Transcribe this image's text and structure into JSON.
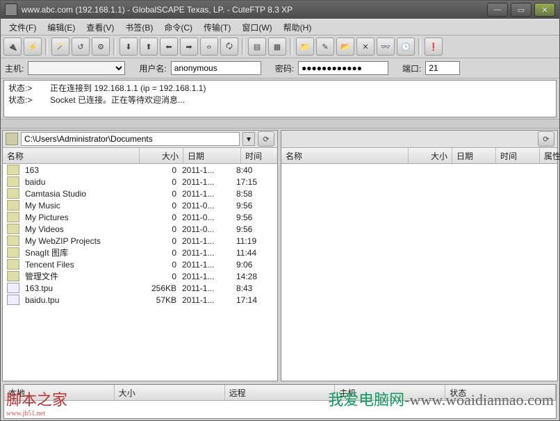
{
  "titlebar": {
    "title": "www.abc.com (192.168.1.1) - GlobalSCAPE Texas, LP. - CuteFTP 8.3 XP"
  },
  "menu": {
    "file": "文件(F)",
    "edit": "编辑(E)",
    "view": "查看(V)",
    "bookmark": "书签(B)",
    "command": "命令(C)",
    "transfer": "传输(T)",
    "window": "窗口(W)",
    "help": "帮助(H)"
  },
  "conn": {
    "host_label": "主机:",
    "host": "",
    "user_label": "用户名:",
    "user": "anonymous",
    "pass_label": "密码:",
    "pass": "●●●●●●●●●●●●",
    "port_label": "端口:",
    "port": "21"
  },
  "log": {
    "prefix": "状态:>",
    "line1": "正在连接到 192.168.1.1 (ip = 192.168.1.1)",
    "line2": "Socket 已连接。正在等待欢迎消息..."
  },
  "local": {
    "path": "C:\\Users\\Administrator\\Documents",
    "cols": {
      "name": "名称",
      "size": "大小",
      "date": "日期",
      "time": "时间"
    },
    "rows": [
      {
        "ic": "d",
        "n": "163",
        "s": "0",
        "d": "2011-1...",
        "t": "8:40"
      },
      {
        "ic": "d",
        "n": "baidu",
        "s": "0",
        "d": "2011-1...",
        "t": "17:15"
      },
      {
        "ic": "d",
        "n": "Camtasia Studio",
        "s": "0",
        "d": "2011-1...",
        "t": "8:58"
      },
      {
        "ic": "d",
        "n": "My Music",
        "s": "0",
        "d": "2011-0...",
        "t": "9:56"
      },
      {
        "ic": "d",
        "n": "My Pictures",
        "s": "0",
        "d": "2011-0...",
        "t": "9:56"
      },
      {
        "ic": "d",
        "n": "My Videos",
        "s": "0",
        "d": "2011-0...",
        "t": "9:56"
      },
      {
        "ic": "d",
        "n": "My WebZIP Projects",
        "s": "0",
        "d": "2011-1...",
        "t": "11:19"
      },
      {
        "ic": "d",
        "n": "SnagIt 图库",
        "s": "0",
        "d": "2011-1...",
        "t": "11:44"
      },
      {
        "ic": "d",
        "n": "Tencent Files",
        "s": "0",
        "d": "2011-1...",
        "t": "9:06"
      },
      {
        "ic": "d",
        "n": "管理文件",
        "s": "0",
        "d": "2011-1...",
        "t": "14:28"
      },
      {
        "ic": "f",
        "n": "163.tpu",
        "s": "256KB",
        "d": "2011-1...",
        "t": "8:43"
      },
      {
        "ic": "f",
        "n": "baidu.tpu",
        "s": "57KB",
        "d": "2011-1...",
        "t": "17:14"
      }
    ]
  },
  "remote": {
    "cols": {
      "name": "名称",
      "size": "大小",
      "date": "日期",
      "time": "时间",
      "attr": "属性"
    }
  },
  "queue": {
    "cols": {
      "local": "本地",
      "size": "大小",
      "remote": "远程",
      "host": "主机",
      "status": "状态"
    }
  },
  "watermark": {
    "left": "脚本之家",
    "left_url": "www.jb51.net",
    "right_cn": "我爱电脑网",
    "right_url": "-www.woaidiannao.com"
  }
}
